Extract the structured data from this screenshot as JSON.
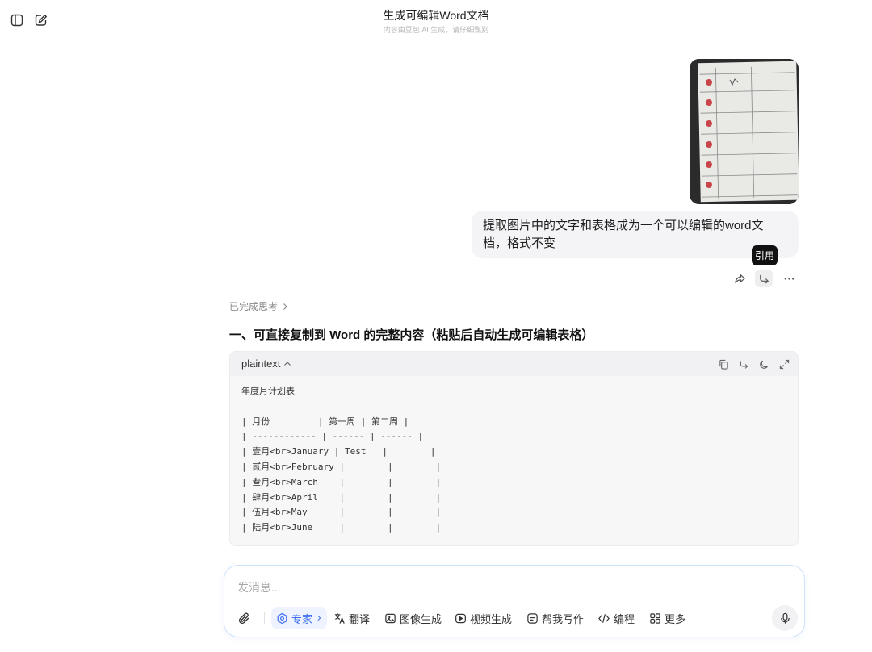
{
  "header": {
    "title": "生成可编辑Word文档",
    "subtitle": "内容由豆包 AI 生成，请仔细甄别"
  },
  "user_message": {
    "text": "提取图片中的文字和表格成为一个可以编辑的word文档，格式不变"
  },
  "message_actions": {
    "tooltip": "引用"
  },
  "assistant": {
    "thinking_label": "已完成思考",
    "heading": "一、可直接复制到 Word 的完整内容（粘贴后自动生成可编辑表格）",
    "code_block": {
      "language": "plaintext",
      "lines": [
        "年度月计划表",
        "",
        "| 月份         | 第一周 | 第二周 |",
        "| ------------ | ------ | ------ |",
        "| 壹月<br>January | Test   |        |",
        "| 贰月<br>February |        |        |",
        "| 叁月<br>March    |        |        |",
        "| 肆月<br>April    |        |        |",
        "| 伍月<br>May      |        |        |",
        "| 陆月<br>June     |        |        |"
      ]
    }
  },
  "composer": {
    "placeholder": "发消息...",
    "tools": {
      "expert": "专家",
      "translate": "翻译",
      "image_gen": "图像生成",
      "video_gen": "视频生成",
      "write": "帮我写作",
      "code": "编程",
      "more": "更多"
    }
  },
  "colors": {
    "accent": "#3b6cf0",
    "bubble": "#f4f4f6",
    "code_bg": "#f7f7f8"
  }
}
